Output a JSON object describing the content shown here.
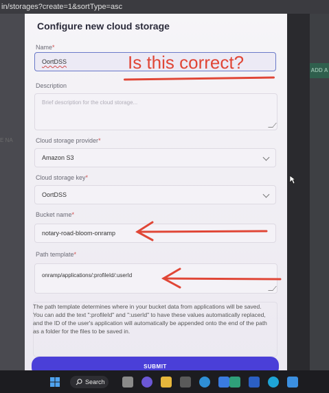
{
  "browser": {
    "url_fragment": "in/storages?create=1&sortType=asc"
  },
  "background": {
    "left_label": "E NA",
    "right_button": "ADD A"
  },
  "modal": {
    "title": "Configure new cloud storage",
    "name": {
      "label": "Name",
      "required_mark": "*",
      "value": "OortDSS"
    },
    "description": {
      "label": "Description",
      "placeholder": "Brief description for the cloud storage..."
    },
    "provider": {
      "label": "Cloud storage provider",
      "required_mark": "*",
      "value": "Amazon S3"
    },
    "key": {
      "label": "Cloud storage key",
      "required_mark": "*",
      "value": "OortDSS"
    },
    "bucket": {
      "label": "Bucket name",
      "required_mark": "*",
      "value": "notary-road-bloom-onramp"
    },
    "path": {
      "label": "Path template",
      "required_mark": "*",
      "value": "onramp/applications/:profileId/:userId"
    },
    "help": "The path template determines where in your bucket data from applications will be saved. You can add the text \":profileId\" and \":userId\" to have these values automatically replaced, and the ID of the user's application will automatically be appended onto the end of the path as a folder for the files to be saved in.",
    "submit_label": "SUBMIT"
  },
  "annotation": {
    "text": "Is this correct?",
    "color": "#e04636"
  },
  "taskbar": {
    "search_label": "Search"
  },
  "colors": {
    "accent": "#4a3fd8",
    "annotation": "#e04636",
    "focus": "#6878c8"
  }
}
